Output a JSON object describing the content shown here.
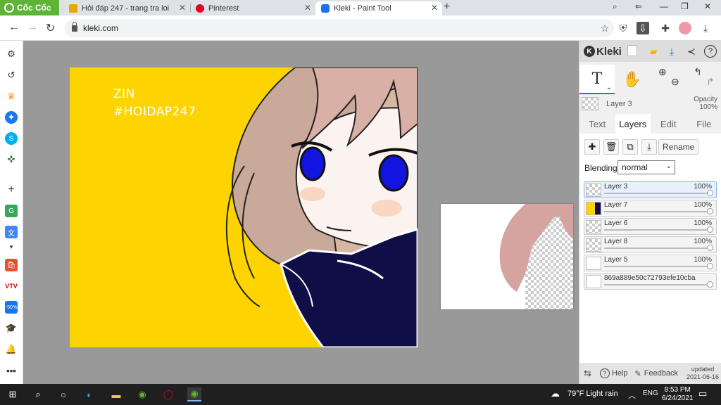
{
  "browser": {
    "brand": "Cốc Cốc",
    "tabs": [
      {
        "title": "Hỏi đáp 247 - trang tra loi",
        "active": false
      },
      {
        "title": "Pinterest",
        "active": false
      },
      {
        "title": "Kleki - Paint Tool",
        "active": true
      }
    ],
    "new_tab": "+",
    "address": "kleki.com",
    "colors": {
      "brand": "#5fb336",
      "tab_bg": "#dee1e6"
    }
  },
  "canvas": {
    "caption_line1": "ZIN",
    "caption_line2": "#HOIDAP247",
    "background_color": "#fdd402"
  },
  "kleki": {
    "brand": "Kleki",
    "current_layer": "Layer 3",
    "opacity_label": "Opacity",
    "opacity_value": "100%",
    "tabs": [
      "Text",
      "Layers",
      "Edit",
      "File"
    ],
    "active_tab": "Layers",
    "rename_label": "Rename",
    "blending_label": "Blending",
    "blending_value": "normal",
    "layers": [
      {
        "name": "Layer 3",
        "opacity": "100%",
        "selected": true
      },
      {
        "name": "Layer 7",
        "opacity": "100%",
        "selected": false
      },
      {
        "name": "Layer 6",
        "opacity": "100%",
        "selected": false
      },
      {
        "name": "Layer 8",
        "opacity": "100%",
        "selected": false
      },
      {
        "name": "Layer 5",
        "opacity": "100%",
        "selected": false
      },
      {
        "name": "869a889e50c72793efe10cba",
        "opacity": "100%",
        "selected": false
      }
    ],
    "footer": {
      "help": "Help",
      "feedback": "Feedback",
      "updated_label": "updated",
      "updated_date": "2021-06-16"
    }
  },
  "taskbar": {
    "weather": "79°F Light rain",
    "lang": "ENG",
    "time": "8:53 PM",
    "date": "6/24/2021"
  }
}
